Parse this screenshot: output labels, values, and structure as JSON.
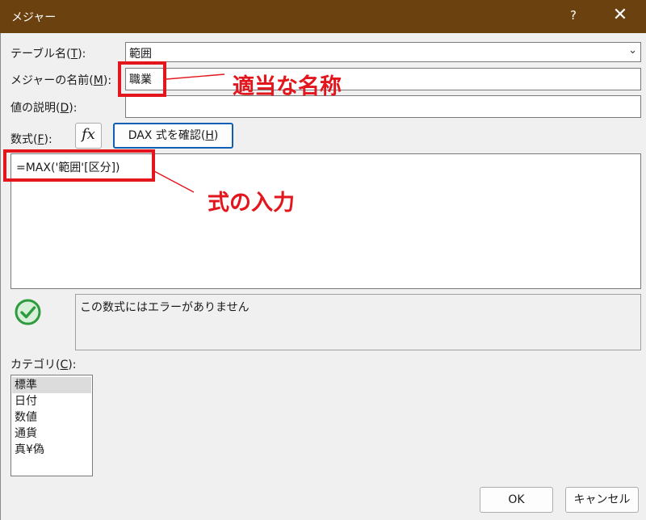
{
  "window": {
    "title": "メジャー",
    "help": "?",
    "close": "✕"
  },
  "table_name": {
    "label_prefix": "テーブル名(",
    "label_key": "T",
    "label_suffix": "):",
    "value": "範囲"
  },
  "measure_name": {
    "label_prefix": "メジャーの名前(",
    "label_key": "M",
    "label_suffix": "):",
    "value": "職業"
  },
  "description": {
    "label_prefix": "値の説明(",
    "label_key": "D",
    "label_suffix": "):",
    "value": ""
  },
  "formula": {
    "label_prefix": "数式(",
    "label_key": "F",
    "label_suffix": "):",
    "fx": "fx",
    "check_prefix": "DAX 式を確認(",
    "check_key": "H",
    "check_suffix": ")",
    "value": "=MAX('範囲'[区分])"
  },
  "status": {
    "message": "この数式にはエラーがありません",
    "icon": "check-circle-icon",
    "color": "#2e9b3e"
  },
  "category": {
    "label_prefix": "カテゴリ(",
    "label_key": "C",
    "label_suffix": "):",
    "items": [
      "標準",
      "日付",
      "数値",
      "通貨",
      "真¥偽"
    ],
    "selected": 0
  },
  "buttons": {
    "ok": "OK",
    "cancel": "キャンセル"
  },
  "annotations": {
    "name": "適当な名称",
    "formula": "式の入力",
    "color": "#e2161c"
  },
  "theme": {
    "titlebar": "#6b4110",
    "panel": "#f0f0f0"
  }
}
